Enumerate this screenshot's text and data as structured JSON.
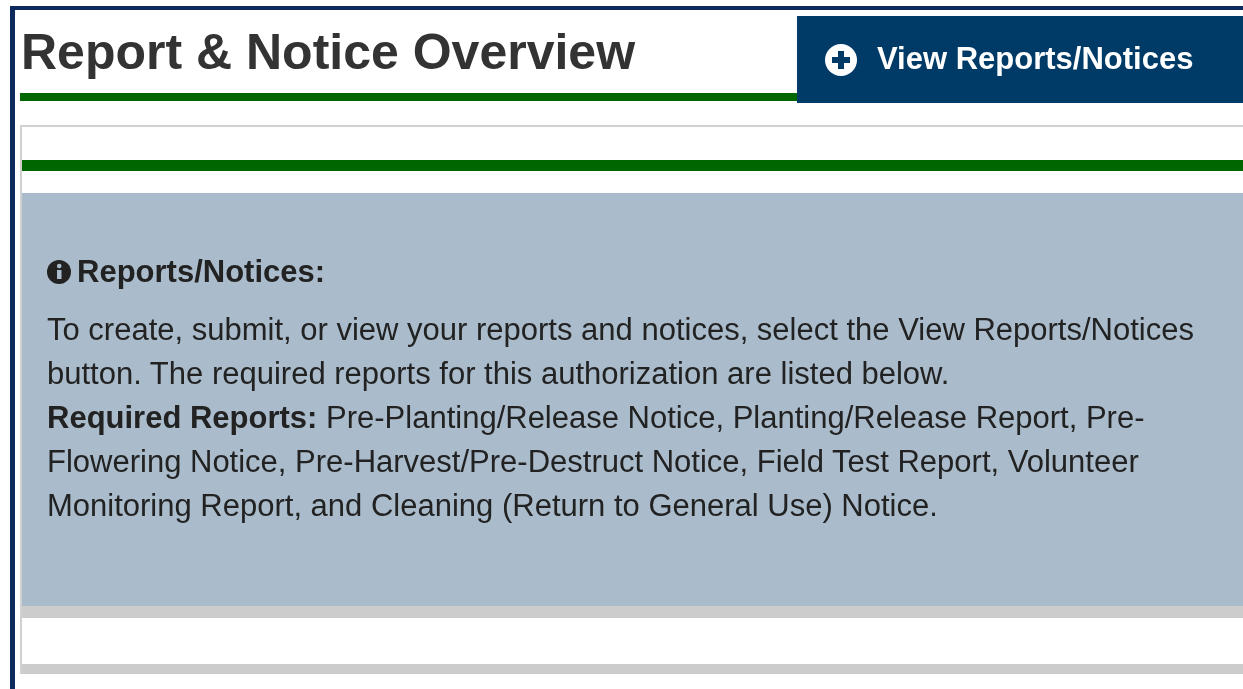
{
  "header": {
    "title": "Report & Notice Overview",
    "button": "View Reports/Notices"
  },
  "info": {
    "heading": "Reports/Notices:",
    "text": "To create, submit, or view your reports and notices, select the View Reports/Notices button. The required reports for this authorization are listed below.",
    "required": "**Required Reports:** Pre-Planting/Release Notice, Planting/Release Report, Pre-Flowering Notice, Pre-Harvest/Pre-Destruct Notice, Field Test Report, Volunteer Monitoring Report, and Cleaning (Return to General Use) Notice."
  }
}
